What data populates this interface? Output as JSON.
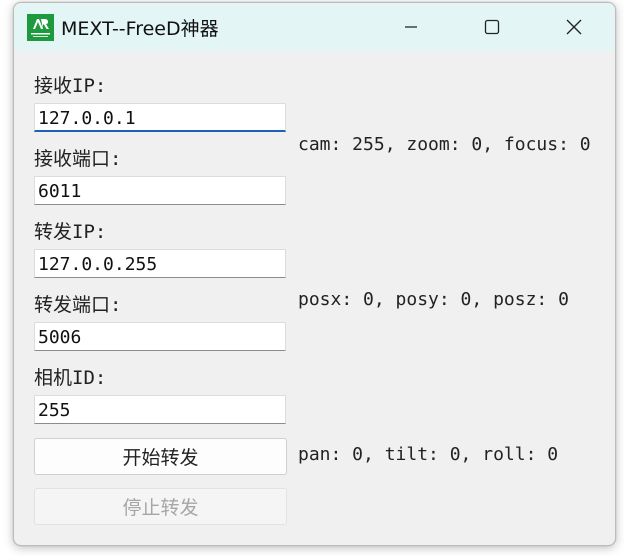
{
  "window": {
    "title": "MEXT--FreeD神器",
    "icon": "app-logo-icon",
    "accent_color": "#1e9a3e",
    "titlebar_color": "#e3f5f5"
  },
  "form": {
    "receive_ip_label": "接收IP:",
    "receive_ip_value": "127.0.0.1",
    "receive_port_label": "接收端口:",
    "receive_port_value": "6011",
    "forward_ip_label": "转发IP:",
    "forward_ip_value": "127.0.0.255",
    "forward_port_label": "转发端口:",
    "forward_port_value": "5006",
    "camera_id_label": "相机ID:",
    "camera_id_value": "255"
  },
  "buttons": {
    "start_label": "开始转发",
    "stop_label": "停止转发"
  },
  "status": {
    "cam_line": "cam: 255, zoom: 0, focus: 0",
    "pos_line": "posx: 0, posy: 0, posz: 0",
    "rot_line": "pan: 0, tilt: 0, roll: 0"
  }
}
